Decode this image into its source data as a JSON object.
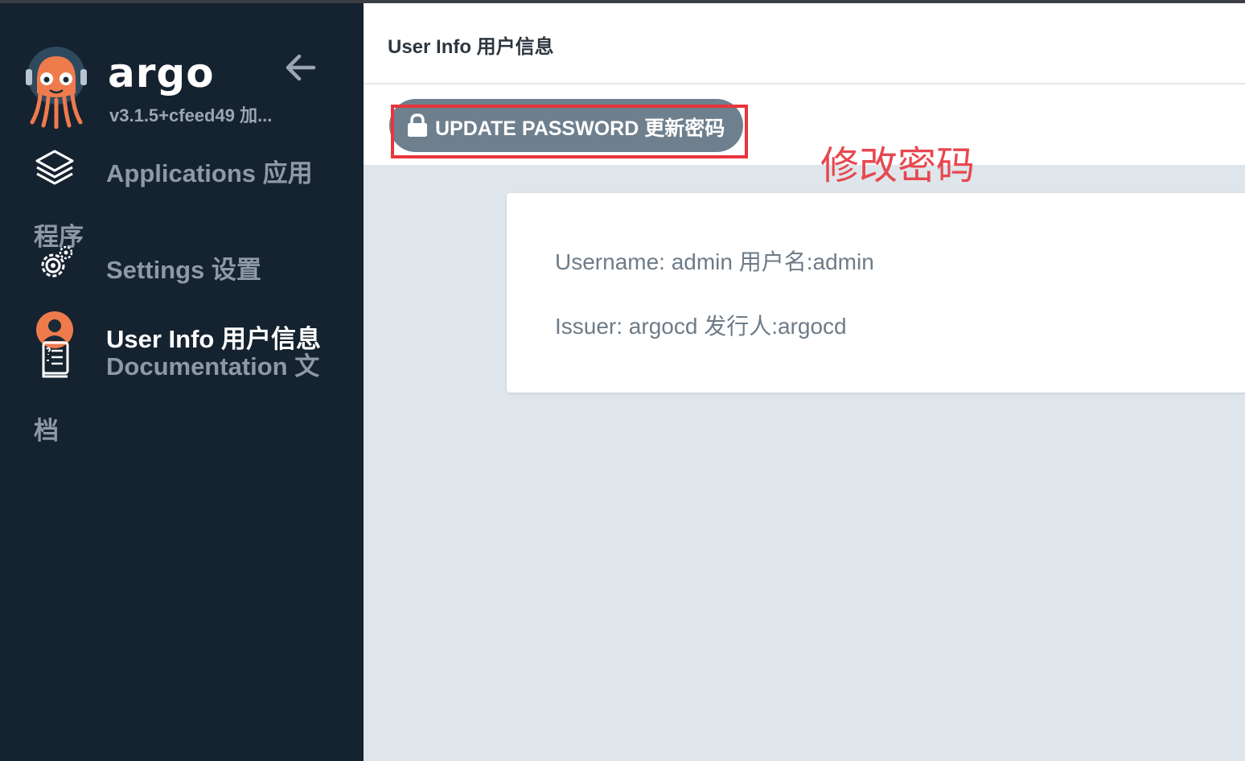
{
  "app": {
    "brand": "argo",
    "version": "v3.1.5+cfeed49 加..."
  },
  "sidebar": {
    "items": [
      {
        "label_line1": "Applications 应用",
        "label_line2": "程序",
        "icon": "layers-icon"
      },
      {
        "label": "Settings 设置",
        "icon": "gears-icon"
      },
      {
        "label": "User Info 用户信息",
        "icon": "user-icon",
        "active": true
      },
      {
        "label_line1": "Documentation 文",
        "label_line2": "档",
        "icon": "docs-icon"
      }
    ]
  },
  "header": {
    "title": "User Info 用户信息"
  },
  "toolbar": {
    "update_password_label": "UPDATE PASSWORD 更新密码"
  },
  "annotation": {
    "text": "修改密码",
    "color": "#e8474f"
  },
  "userinfo": {
    "username": "Username: admin 用户名:admin",
    "issuer": "Issuer: argocd 发行人:argocd"
  },
  "colors": {
    "sidebar_bg": "#15222f",
    "button_bg": "#6e7f8d",
    "accent_orange": "#ef7b4d",
    "highlight_red": "#e8363d"
  }
}
